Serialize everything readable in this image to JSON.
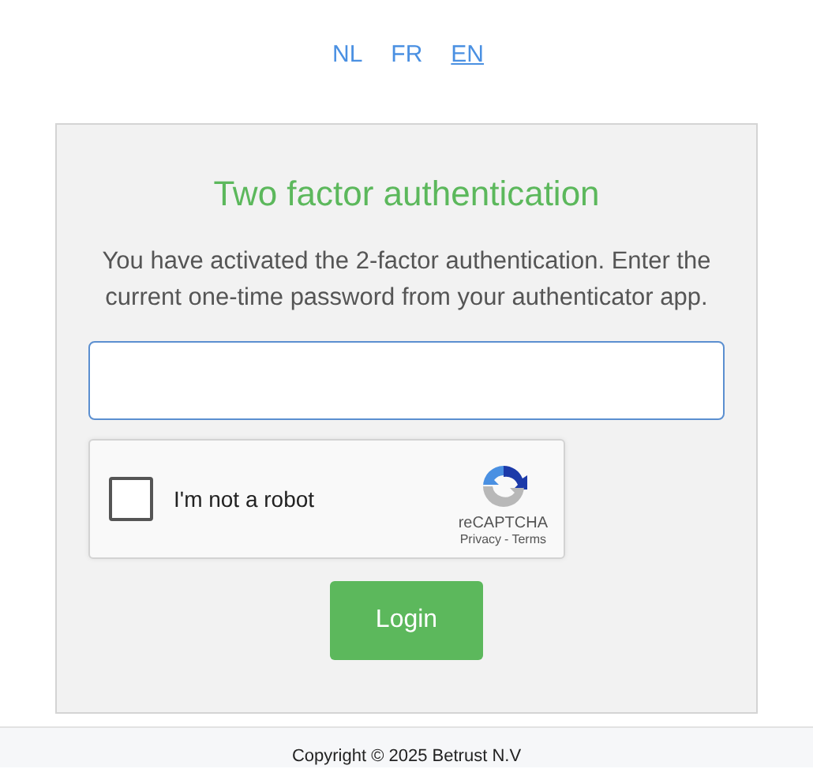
{
  "languages": [
    {
      "label": "NL",
      "selected": false
    },
    {
      "label": "FR",
      "selected": false
    },
    {
      "label": "EN",
      "selected": true
    }
  ],
  "card": {
    "title": "Two factor authentication",
    "message": "You have activated the 2-factor authentication. Enter the current one-time password from your authenticator app.",
    "captcha": {
      "label": "I'm not a robot",
      "checked": false,
      "brand": "reCAPTCHA",
      "privacy": "Privacy",
      "separator": "-",
      "terms": "Terms"
    },
    "login_button": "Login"
  },
  "footer": "Copyright © 2025 Betrust N.V"
}
